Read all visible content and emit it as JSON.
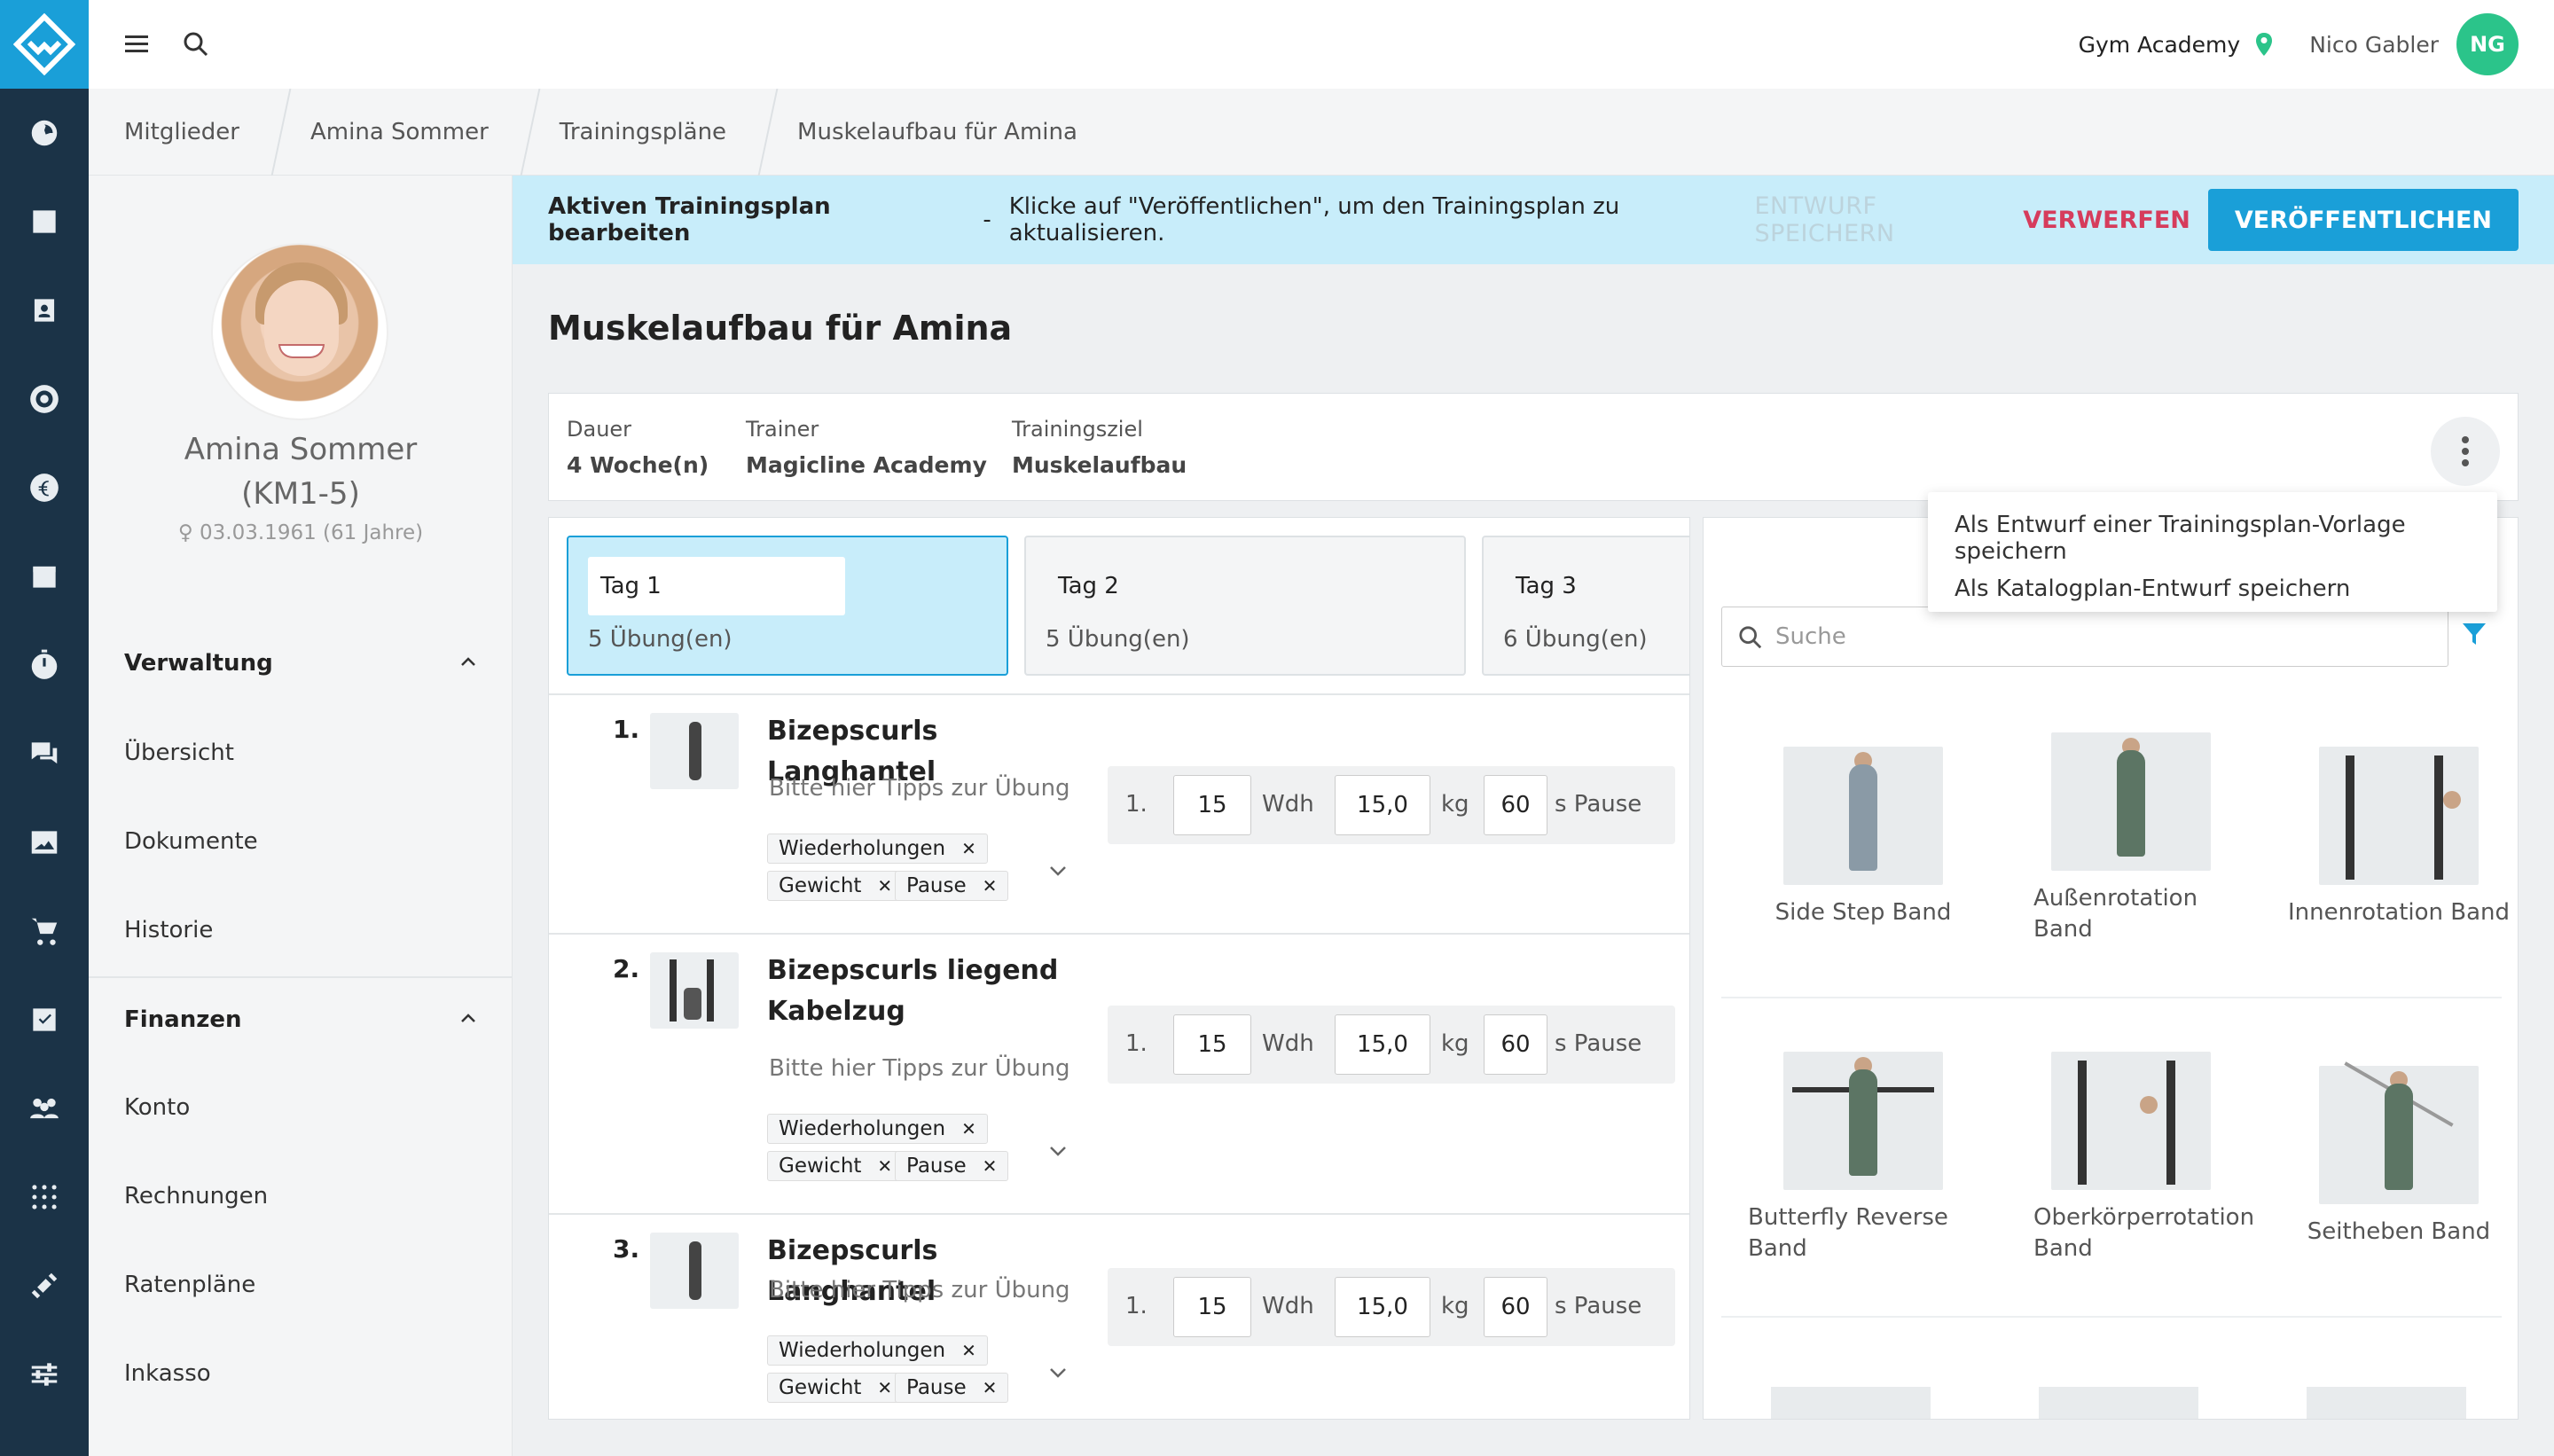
{
  "topbar": {
    "studio": "Gym Academy",
    "user_name": "Nico Gabler",
    "user_initials": "NG"
  },
  "breadcrumbs": [
    "Mitglieder",
    "Amina Sommer",
    "Trainingspläne",
    "Muskelaufbau für Amina"
  ],
  "member": {
    "name": "Amina Sommer",
    "id": "(KM1-5)",
    "dob": "03.03.1961 (61 Jahre)"
  },
  "sidebar": {
    "sections": [
      {
        "title": "Verwaltung",
        "items": [
          "Übersicht",
          "Dokumente",
          "Historie"
        ]
      },
      {
        "title": "Finanzen",
        "items": [
          "Konto",
          "Rechnungen",
          "Ratenpläne",
          "Inkasso"
        ]
      }
    ]
  },
  "banner": {
    "title": "Aktiven Trainingsplan bearbeiten",
    "separator": "-",
    "message": "Klicke auf \"Veröffentlichen\", um den Trainingsplan zu aktualisieren.",
    "save_draft": "ENTWURF SPEICHERN",
    "discard": "VERWERFEN",
    "publish": "VERÖFFENTLICHEN"
  },
  "plan": {
    "title": "Muskelaufbau für Amina",
    "fields": [
      {
        "label": "Dauer",
        "value": "4 Woche(n)"
      },
      {
        "label": "Trainer",
        "value": "Magicline Academy"
      },
      {
        "label": "Trainingsziel",
        "value": "Muskelaufbau"
      }
    ]
  },
  "menu": {
    "items": [
      "Als Entwurf einer Trainingsplan-Vorlage speichern",
      "Als Katalogplan-Entwurf speichern"
    ]
  },
  "days": [
    {
      "name": "Tag 1",
      "count": "5 Übung(en)"
    },
    {
      "name": "Tag 2",
      "count": "5 Übung(en)"
    },
    {
      "name": "Tag 3",
      "count": "6 Übung(en)"
    }
  ],
  "exercise_labels": {
    "tip": "Bitte hier Tipps zur Übung",
    "tag_reps": "Wiederholungen",
    "tag_weight": "Gewicht",
    "tag_pause": "Pause",
    "wdh": "Wdh",
    "kg": "kg",
    "pause": "s Pause",
    "set_no": "1."
  },
  "exercises": [
    {
      "num": "1.",
      "name": "Bizepscurls Langhantel",
      "reps": "15",
      "weight": "15,0",
      "pause": "60"
    },
    {
      "num": "2.",
      "name": "Bizepscurls liegend Kabelzug",
      "reps": "15",
      "weight": "15,0",
      "pause": "60"
    },
    {
      "num": "3.",
      "name": "Bizepscurls Langhantel",
      "reps": "15",
      "weight": "15,0",
      "pause": "60"
    }
  ],
  "catalog": {
    "search_placeholder": "Suche",
    "items": [
      "Side Step Band",
      "Außenrotation Band",
      "Innenrotation Band",
      "Butterfly Reverse Band",
      "Oberkörperrotation Band",
      "Seitheben Band"
    ]
  },
  "colors": {
    "rail": "#1b3347",
    "accent": "#1a9fd8",
    "banner": "#c8edfa",
    "discard": "#d63c5c",
    "avatar": "#2bc48a"
  }
}
